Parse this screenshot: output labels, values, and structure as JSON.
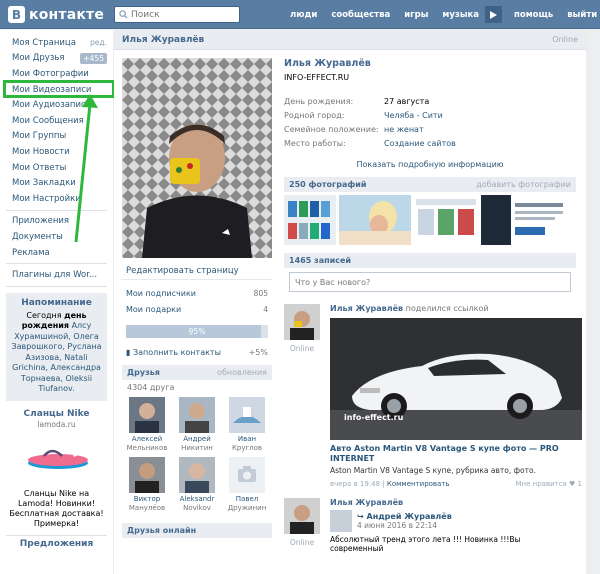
{
  "header": {
    "logo_text": "контакте",
    "logo_letter": "В",
    "search_placeholder": "Поиск",
    "menu": [
      "люди",
      "сообщества",
      "игры",
      "музыка",
      "помощь",
      "выйти"
    ]
  },
  "sidebar": {
    "items": [
      {
        "label": "Моя Страница",
        "extra": "ред."
      },
      {
        "label": "Мои Друзья",
        "extra": "+455"
      },
      {
        "label": "Мои Фотографии",
        "extra": ""
      },
      {
        "label": "Мои Видеозаписи",
        "extra": ""
      },
      {
        "label": "Мои Аудиозаписи",
        "extra": ""
      },
      {
        "label": "Мои Сообщения",
        "extra": ""
      },
      {
        "label": "Мои Группы",
        "extra": ""
      },
      {
        "label": "Мои Новости",
        "extra": ""
      },
      {
        "label": "Мои Ответы",
        "extra": ""
      },
      {
        "label": "Мои Закладки",
        "extra": ""
      },
      {
        "label": "Мои Настройки",
        "extra": ""
      }
    ],
    "items2": [
      "Приложения",
      "Документы",
      "Реклама"
    ],
    "items3": [
      "Плагины для Wor..."
    ],
    "reminder": {
      "title": "Напоминание",
      "l1": "Сегодня ",
      "l1b": "день рождения",
      "l1c": " ",
      "names": "Алсу Хурамшиной, Олега Заврошкого, Руслана Азизова, Natali Grichina, Александра Торнаева, Oleksii Tiufanov."
    },
    "ad": {
      "title": "Сланцы Nike",
      "domain": "lamoda.ru",
      "text": "Сланцы Nike на Lamoda! Новинки! Бесплатная доставка! Примерка!",
      "footer": "Предложения"
    }
  },
  "profile": {
    "name": "Илья Журавлёв",
    "online": "Online",
    "status": "INFO-EFFECT.RU",
    "info": [
      {
        "k": "День рождения:",
        "v": "27 августа"
      },
      {
        "k": "Родной город:",
        "v": "Челяба - Сити"
      },
      {
        "k": "Семейное положение:",
        "v": "не женат"
      },
      {
        "k": "Место работы:",
        "v": "Создание сайтов"
      }
    ],
    "more": "Показать подробную информацию",
    "edit": "Редактировать страницу",
    "subs_label": "Мои подписчики",
    "subs": "805",
    "gifts_label": "Мои подарки",
    "gifts": "4",
    "progress": 0.95,
    "progress_label": "95%",
    "fill_label": "Заполнить контакты",
    "fill_value": "+5%"
  },
  "friends": {
    "title": "Друзья",
    "updates": "обновления",
    "count": "4304 друга",
    "list": [
      {
        "first": "Алексей",
        "last": "Мельников"
      },
      {
        "first": "Андрей",
        "last": "Никитин"
      },
      {
        "first": "Иван",
        "last": "Круглов"
      },
      {
        "first": "Виктор",
        "last": "Манулёов"
      },
      {
        "first": "Aleksandr",
        "last": "Novikov"
      },
      {
        "first": "Павел",
        "last": "Дружинин"
      }
    ],
    "online_title": "Друзья онлайн"
  },
  "photos": {
    "title": "250 фотографий",
    "add": "добавить фотографии"
  },
  "wall": {
    "count": "1465 записей",
    "placeholder": "Что у Вас нового?"
  },
  "post1": {
    "author": "Илья Журавлёв",
    "shared": "поделился ссылкой",
    "online": "Online",
    "watermark": "info-effect.ru",
    "title": "Авто Aston Martin V8 Vantage S купе фото — PRO INTERNET",
    "desc": "Aston Martin V8 Vantage S купе, рубрика авто, фото.",
    "time": "вчера в 19:48",
    "comment": "Комментировать",
    "like": "Мне нравится",
    "likes": "1"
  },
  "post2": {
    "author": "Илья Журавлёв",
    "online": "Online",
    "subname": "Андрей Журавлёв",
    "subdate": "4 июня 2016 в 22:14",
    "text": "Абсолютный тренд этого лета !!! Новинка !!!Вы современный"
  },
  "colors": {
    "topbar": "#597da3",
    "highlight": "#2db83d",
    "link": "#2b587a"
  }
}
